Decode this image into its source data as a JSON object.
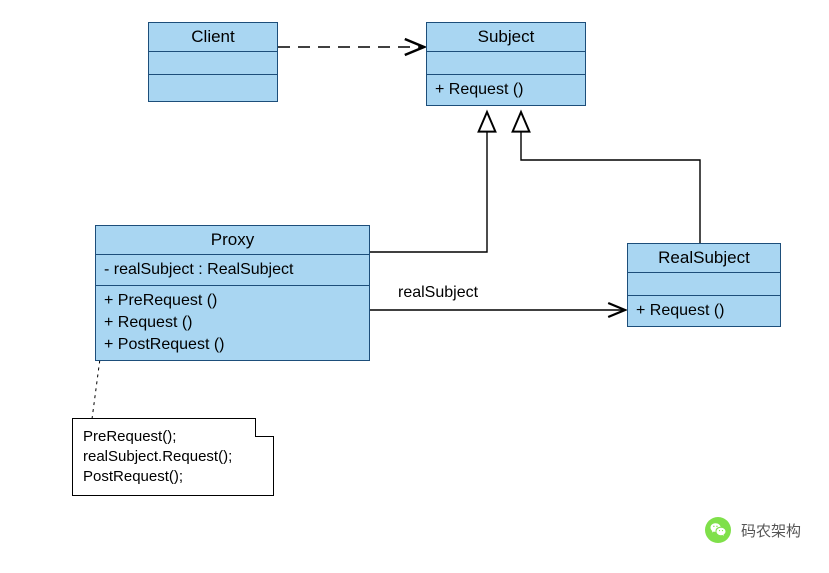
{
  "classes": {
    "client": {
      "name": "Client",
      "attributes": [],
      "operations": []
    },
    "subject": {
      "name": "Subject",
      "attributes": [],
      "operations": [
        "+ Request ()"
      ]
    },
    "proxy": {
      "name": "Proxy",
      "attributes": [
        "- realSubject : RealSubject"
      ],
      "operations": [
        "+ PreRequest ()",
        "+ Request ()",
        "+ PostRequest ()"
      ]
    },
    "realsubject": {
      "name": "RealSubject",
      "attributes": [],
      "operations": [
        "+ Request ()"
      ]
    }
  },
  "note": {
    "lines": [
      "PreRequest();",
      "realSubject.Request();",
      "PostRequest();"
    ]
  },
  "edges": {
    "assoc_label": "realSubject"
  },
  "relationships": [
    {
      "from": "Client",
      "to": "Subject",
      "type": "dependency",
      "style": "dashed-open-arrow"
    },
    {
      "from": "Proxy",
      "to": "Subject",
      "type": "generalization",
      "style": "solid-hollow-arrow"
    },
    {
      "from": "RealSubject",
      "to": "Subject",
      "type": "generalization",
      "style": "solid-hollow-arrow"
    },
    {
      "from": "Proxy",
      "to": "RealSubject",
      "type": "association",
      "label": "realSubject",
      "style": "solid-open-arrow"
    },
    {
      "from": "Note",
      "to": "Proxy",
      "type": "note-anchor",
      "style": "dashed"
    }
  ],
  "watermark": {
    "text": "码农架构"
  }
}
